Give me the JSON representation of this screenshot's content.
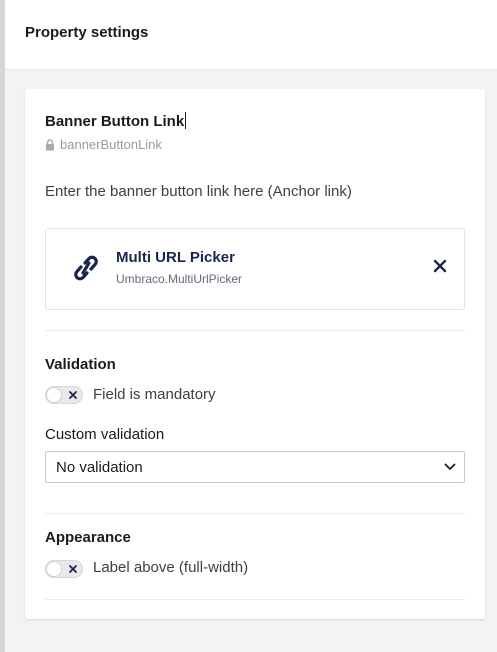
{
  "header": {
    "title": "Property settings"
  },
  "property": {
    "name": "Banner Button Link",
    "alias": "bannerButtonLink",
    "description": "Enter the banner button link here (Anchor link)"
  },
  "editor": {
    "name": "Multi URL Picker",
    "alias": "Umbraco.MultiUrlPicker",
    "icon": "link-icon"
  },
  "validation": {
    "title": "Validation",
    "mandatory_label": "Field is mandatory",
    "mandatory_on": false,
    "custom_label": "Custom validation",
    "custom_value": "No validation"
  },
  "appearance": {
    "title": "Appearance",
    "label_above_label": "Label above (full-width)",
    "label_above_on": false
  },
  "colors": {
    "primary_text": "#1b264f",
    "page_bg": "#f3f3f5"
  }
}
